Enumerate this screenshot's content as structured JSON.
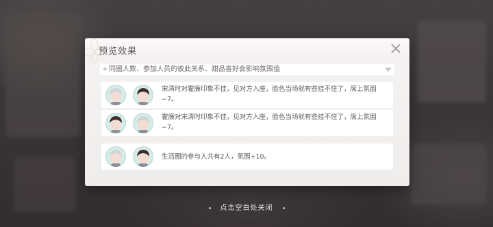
{
  "dialog": {
    "title": "预览效果",
    "hint_prefix": "+",
    "hint": "同圈人数、参加人员的彼此关系、甜品喜好会影响氛围值",
    "close_icon": "close-icon"
  },
  "effects": [
    {
      "avatars": [
        {
          "name": "silver-hair-avatar",
          "hair": "#cfd3d8"
        },
        {
          "name": "dark-hair-avatar",
          "hair": "#3a2e2f"
        }
      ],
      "text": "宋清时对霍廉印象不佳，见对方入座，脸色当场就有些挂不住了，席上氛围−7。"
    },
    {
      "avatars": [
        {
          "name": "dark-hair-avatar",
          "hair": "#3a2e2f"
        },
        {
          "name": "silver-hair-avatar",
          "hair": "#cfd3d8"
        }
      ],
      "text": "霍廉对宋清时印象不佳，见对方入座，脸色当场就有些挂不住了，席上氛围−7。"
    },
    {
      "avatars": [
        {
          "name": "silver-hair-avatar",
          "hair": "#cfd3d8"
        },
        {
          "name": "dark-hair-avatar",
          "hair": "#3a2e2f"
        }
      ],
      "text": "生活圈的参与人共有2人，氛围+10。"
    }
  ],
  "footer": {
    "hint": "点击空白处关闭"
  },
  "colors": {
    "avatar_bg": "#d6ece8",
    "dialog_bg": "#f6f4f3",
    "text": "#5f585c"
  }
}
